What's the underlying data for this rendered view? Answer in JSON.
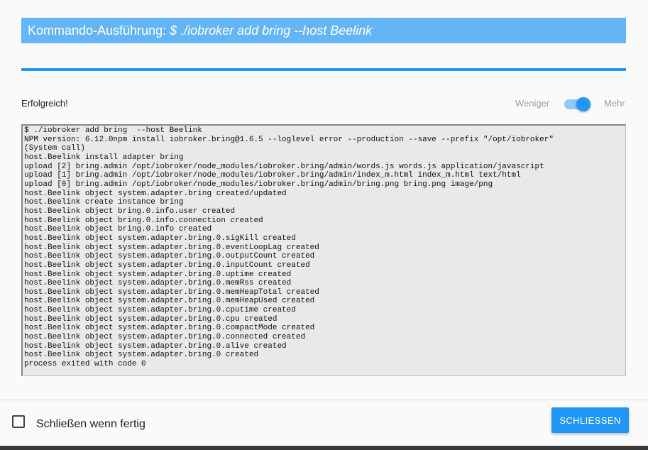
{
  "dialog": {
    "title_prefix": "Kommando-Ausführung: ",
    "title_command": "$ ./iobroker add bring --host Beelink",
    "status": "Erfolgreich!",
    "toggle_less": "Weniger",
    "toggle_more": "Mehr",
    "toggle_state": "on",
    "progress": 1.0,
    "log_lines": [
      "$ ./iobroker add bring  --host Beelink",
      "NPM version: 6.12.0npm install iobroker.bring@1.6.5 --loglevel error --production --save --prefix \"/opt/iobroker\"",
      "(System call)",
      "host.Beelink install adapter bring",
      "upload [2] bring.admin /opt/iobroker/node_modules/iobroker.bring/admin/words.js words.js application/javascript",
      "upload [1] bring.admin /opt/iobroker/node_modules/iobroker.bring/admin/index_m.html index_m.html text/html",
      "upload [0] bring.admin /opt/iobroker/node_modules/iobroker.bring/admin/bring.png bring.png image/png",
      "host.Beelink object system.adapter.bring created/updated",
      "host.Beelink create instance bring",
      "host.Beelink object bring.0.info.user created",
      "host.Beelink object bring.0.info.connection created",
      "host.Beelink object bring.0.info created",
      "host.Beelink object system.adapter.bring.0.sigKill created",
      "host.Beelink object system.adapter.bring.0.eventLoopLag created",
      "host.Beelink object system.adapter.bring.0.outputCount created",
      "host.Beelink object system.adapter.bring.0.inputCount created",
      "host.Beelink object system.adapter.bring.0.uptime created",
      "host.Beelink object system.adapter.bring.0.memRss created",
      "host.Beelink object system.adapter.bring.0.memHeapTotal created",
      "host.Beelink object system.adapter.bring.0.memHeapUsed created",
      "host.Beelink object system.adapter.bring.0.cputime created",
      "host.Beelink object system.adapter.bring.0.cpu created",
      "host.Beelink object system.adapter.bring.0.compactMode created",
      "host.Beelink object system.adapter.bring.0.connected created",
      "host.Beelink object system.adapter.bring.0.alive created",
      "host.Beelink object system.adapter.bring.0 created",
      "process exited with code 0"
    ],
    "close_when_done_label": "Schließen wenn fertig",
    "close_when_done_checked": false,
    "close_button": "SCHLIESSEN"
  },
  "colors": {
    "accent": "#2196f3",
    "title_bg": "#64b5f6",
    "log_bg": "#e9e9e9"
  }
}
